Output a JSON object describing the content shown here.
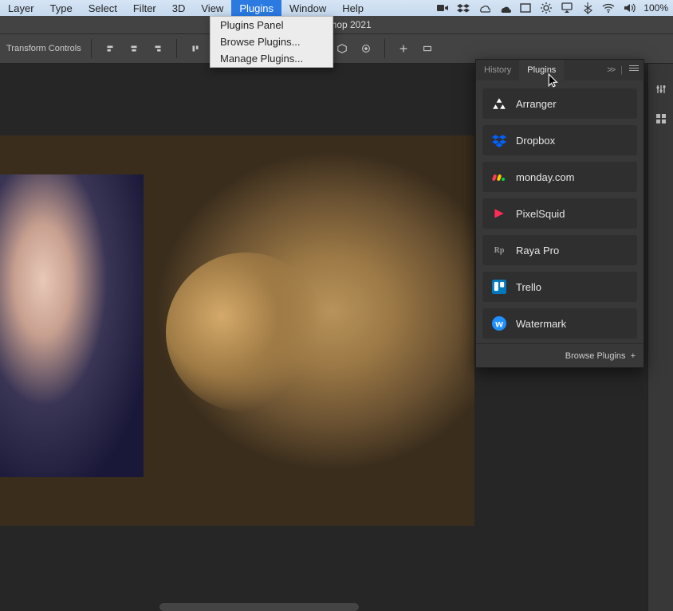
{
  "menubar": {
    "items": [
      "Layer",
      "Type",
      "Select",
      "Filter",
      "3D",
      "View",
      "Plugins",
      "Window",
      "Help"
    ],
    "active_index": 6,
    "battery": "100%"
  },
  "dropdown": {
    "items": [
      "Plugins Panel",
      "Browse Plugins...",
      "Manage Plugins..."
    ]
  },
  "titlebar": {
    "title": "Photoshop 2021"
  },
  "optionsbar": {
    "label": "Transform Controls"
  },
  "panel": {
    "tabs": [
      {
        "label": "History",
        "active": false
      },
      {
        "label": "Plugins",
        "active": true
      }
    ],
    "collapse_glyph": ">>",
    "items": [
      {
        "name": "Arranger",
        "icon": "arranger",
        "color": "#ffffff"
      },
      {
        "name": "Dropbox",
        "icon": "dropbox",
        "color": "#0061ff"
      },
      {
        "name": "monday.com",
        "icon": "monday",
        "color": "#ff3d57"
      },
      {
        "name": "PixelSquid",
        "icon": "pixelsquid",
        "color": "#ff2d55"
      },
      {
        "name": "Raya Pro",
        "icon": "rayapro",
        "color": "#888888"
      },
      {
        "name": "Trello",
        "icon": "trello",
        "color": "#0079bf"
      },
      {
        "name": "Watermark",
        "icon": "watermark",
        "color": "#1e90ff"
      }
    ],
    "footer": {
      "label": "Browse Plugins",
      "glyph": "+"
    }
  }
}
